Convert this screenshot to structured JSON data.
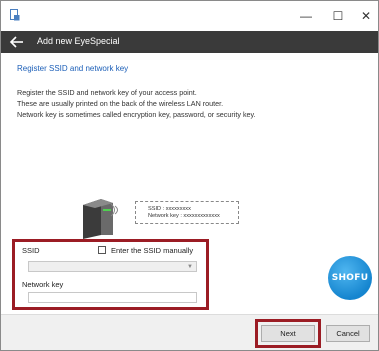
{
  "window": {
    "icons": {
      "app": "app-icon",
      "minimize": "minimize-icon",
      "maximize": "maximize-icon",
      "close": "close-icon"
    },
    "minimize_glyph": "—",
    "maximize_glyph": "☐",
    "close_glyph": "✕"
  },
  "header": {
    "title": "Add new EyeSpecial",
    "back_icon": "back-arrow-icon",
    "background": "#3a3a3a"
  },
  "content": {
    "section_title": "Register SSID and network key",
    "description": [
      "Register the SSID and network key of your access point.",
      "These are usually printed on the back of the wireless LAN router.",
      "Network key is sometimes called encryption key, password, or security key."
    ],
    "callout": {
      "ssid_line": "SSID : xxxxxxxxx",
      "key_line": "Network key : xxxxxxxxxxxxx"
    }
  },
  "form": {
    "ssid_label": "SSID",
    "ssid_manual_label": "Enter the SSID manually",
    "ssid_manual_checked": false,
    "ssid_value": "",
    "network_key_label": "Network key",
    "network_key_value": ""
  },
  "logo": {
    "text": "SHOFU",
    "color": "#1585cf"
  },
  "footer": {
    "next_label": "Next",
    "cancel_label": "Cancel"
  },
  "colors": {
    "highlight": "#9b1c24",
    "accent_text": "#1c5fb8"
  }
}
